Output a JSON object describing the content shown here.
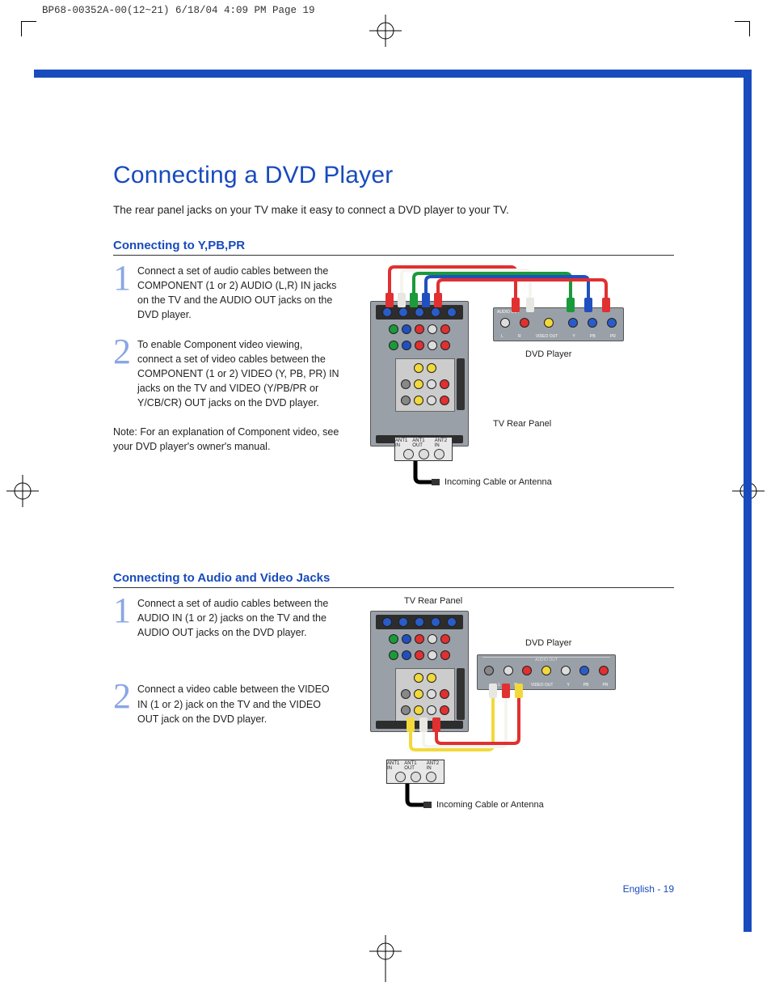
{
  "meta_header": "BP68-00352A-00(12~21)  6/18/04  4:09 PM  Page 19",
  "title": "Connecting a DVD Player",
  "intro": "The rear panel jacks on your TV make it easy to connect a DVD player to your TV.",
  "section1": {
    "heading": "Connecting to Y,PB,PR",
    "step1": "Connect a set of audio cables between the COMPONENT (1 or 2) AUDIO (L,R) IN jacks on the TV and the AUDIO OUT jacks on the DVD player.",
    "step2": "To enable Component video viewing, connect a set of video cables between the COMPONENT (1 or 2) VIDEO (Y, PB, PR) IN jacks on the TV and VIDEO (Y/PB/PR or Y/CB/CR) OUT jacks on the DVD player.",
    "note": "Note: For an explanation of Component video, see your DVD player's owner's manual.",
    "labels": {
      "dvd": "DVD Player",
      "tv": "TV Rear Panel",
      "cable": "Incoming Cable or Antenna"
    }
  },
  "section2": {
    "heading": "Connecting to Audio and Video Jacks",
    "step1": "Connect a set of audio cables between the AUDIO IN (1 or 2) jacks on the TV and the AUDIO OUT jacks on the DVD player.",
    "step2": "Connect a video cable between the VIDEO IN (1 or 2) jack on the TV and the VIDEO OUT jack on the DVD player.",
    "labels": {
      "dvd": "DVD Player",
      "tv": "TV Rear Panel",
      "cable": "Incoming Cable or Antenna"
    }
  },
  "footer": "English - 19"
}
